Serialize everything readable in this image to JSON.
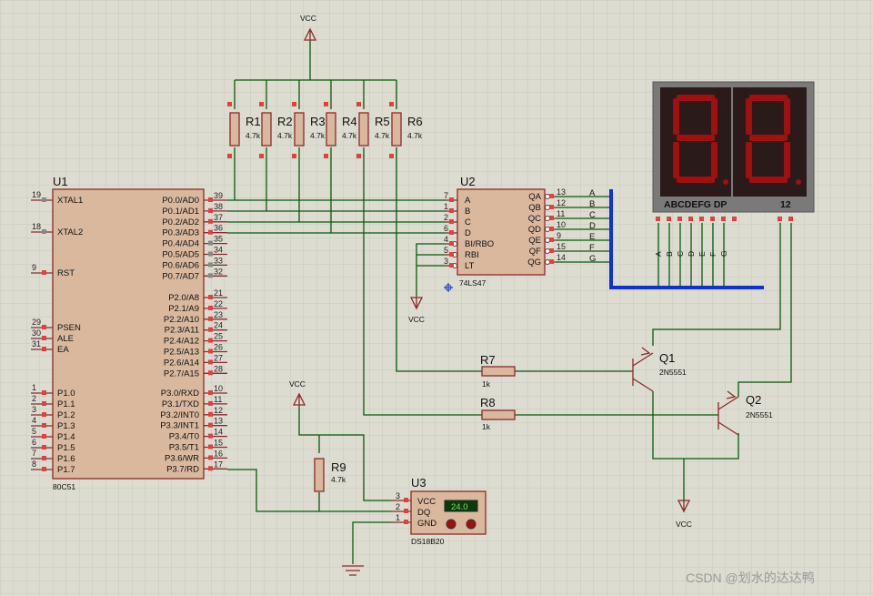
{
  "u1": {
    "ref": "U1",
    "part": "80C51",
    "left_pins": [
      {
        "num": "19",
        "name": "XTAL1"
      },
      {
        "num": "18",
        "name": "XTAL2"
      },
      {
        "num": "9",
        "name": "RST"
      },
      {
        "num": "29",
        "name": "PSEN"
      },
      {
        "num": "30",
        "name": "ALE"
      },
      {
        "num": "31",
        "name": "EA"
      },
      {
        "num": "1",
        "name": "P1.0"
      },
      {
        "num": "2",
        "name": "P1.1"
      },
      {
        "num": "3",
        "name": "P1.2"
      },
      {
        "num": "4",
        "name": "P1.3"
      },
      {
        "num": "5",
        "name": "P1.4"
      },
      {
        "num": "6",
        "name": "P1.5"
      },
      {
        "num": "7",
        "name": "P1.6"
      },
      {
        "num": "8",
        "name": "P1.7"
      }
    ],
    "right_pins": [
      {
        "num": "39",
        "name": "P0.0/AD0"
      },
      {
        "num": "38",
        "name": "P0.1/AD1"
      },
      {
        "num": "37",
        "name": "P0.2/AD2"
      },
      {
        "num": "36",
        "name": "P0.3/AD3"
      },
      {
        "num": "35",
        "name": "P0.4/AD4"
      },
      {
        "num": "34",
        "name": "P0.5/AD5"
      },
      {
        "num": "33",
        "name": "P0.6/AD6"
      },
      {
        "num": "32",
        "name": "P0.7/AD7"
      },
      {
        "num": "21",
        "name": "P2.0/A8"
      },
      {
        "num": "22",
        "name": "P2.1/A9"
      },
      {
        "num": "23",
        "name": "P2.2/A10"
      },
      {
        "num": "24",
        "name": "P2.3/A11"
      },
      {
        "num": "25",
        "name": "P2.4/A12"
      },
      {
        "num": "26",
        "name": "P2.5/A13"
      },
      {
        "num": "27",
        "name": "P2.6/A14"
      },
      {
        "num": "28",
        "name": "P2.7/A15"
      },
      {
        "num": "10",
        "name": "P3.0/RXD"
      },
      {
        "num": "11",
        "name": "P3.1/TXD"
      },
      {
        "num": "12",
        "name": "P3.2/INT0"
      },
      {
        "num": "13",
        "name": "P3.3/INT1"
      },
      {
        "num": "14",
        "name": "P3.4/T0"
      },
      {
        "num": "15",
        "name": "P3.5/T1"
      },
      {
        "num": "16",
        "name": "P3.6/WR"
      },
      {
        "num": "17",
        "name": "P3.7/RD"
      }
    ]
  },
  "u2": {
    "ref": "U2",
    "part": "74LS47",
    "left_pins": [
      {
        "num": "7",
        "name": "A"
      },
      {
        "num": "1",
        "name": "B"
      },
      {
        "num": "2",
        "name": "C"
      },
      {
        "num": "6",
        "name": "D"
      },
      {
        "num": "4",
        "name": "BI/RBO"
      },
      {
        "num": "5",
        "name": "RBI"
      },
      {
        "num": "3",
        "name": "LT"
      }
    ],
    "right_pins": [
      {
        "num": "13",
        "name": "QA",
        "net": "A"
      },
      {
        "num": "12",
        "name": "QB",
        "net": "B"
      },
      {
        "num": "11",
        "name": "QC",
        "net": "C"
      },
      {
        "num": "10",
        "name": "QD",
        "net": "D"
      },
      {
        "num": "9",
        "name": "QE",
        "net": "E"
      },
      {
        "num": "15",
        "name": "QF",
        "net": "F"
      },
      {
        "num": "14",
        "name": "QG",
        "net": "G"
      }
    ]
  },
  "u3": {
    "ref": "U3",
    "part": "DS18B20",
    "readout": "24.0",
    "pins": [
      {
        "num": "3",
        "name": "VCC"
      },
      {
        "num": "2",
        "name": "DQ"
      },
      {
        "num": "1",
        "name": "GND"
      }
    ]
  },
  "resistors": [
    {
      "ref": "R1",
      "value": "4.7k"
    },
    {
      "ref": "R2",
      "value": "4.7k"
    },
    {
      "ref": "R3",
      "value": "4.7k"
    },
    {
      "ref": "R4",
      "value": "4.7k"
    },
    {
      "ref": "R5",
      "value": "4.7k"
    },
    {
      "ref": "R6",
      "value": "4.7k"
    },
    {
      "ref": "R7",
      "value": "1k"
    },
    {
      "ref": "R8",
      "value": "1k"
    },
    {
      "ref": "R9",
      "value": "4.7k"
    }
  ],
  "transistors": [
    {
      "ref": "Q1",
      "part": "2N5551"
    },
    {
      "ref": "Q2",
      "part": "2N5551"
    }
  ],
  "display": {
    "segment_label": "ABCDEFG  DP",
    "digit_label": "12",
    "segment_pins": [
      "A",
      "B",
      "C",
      "D",
      "E",
      "F",
      "G"
    ]
  },
  "power": {
    "vcc_top": "VCC",
    "vcc_u2": "VCC",
    "vcc_r9": "VCC",
    "vcc_q": "VCC"
  },
  "watermark": "CSDN @划水的达达鸭",
  "colors": {
    "background": "#dcdcd0",
    "wire": "#0a5a0a",
    "component": "#8b2a2a",
    "chip_fill": "#d9b89e",
    "pin_marker": "#e04040",
    "bus": "#1030d0",
    "display_bg": "#2a1a1a",
    "segment_on": "#a01010"
  }
}
